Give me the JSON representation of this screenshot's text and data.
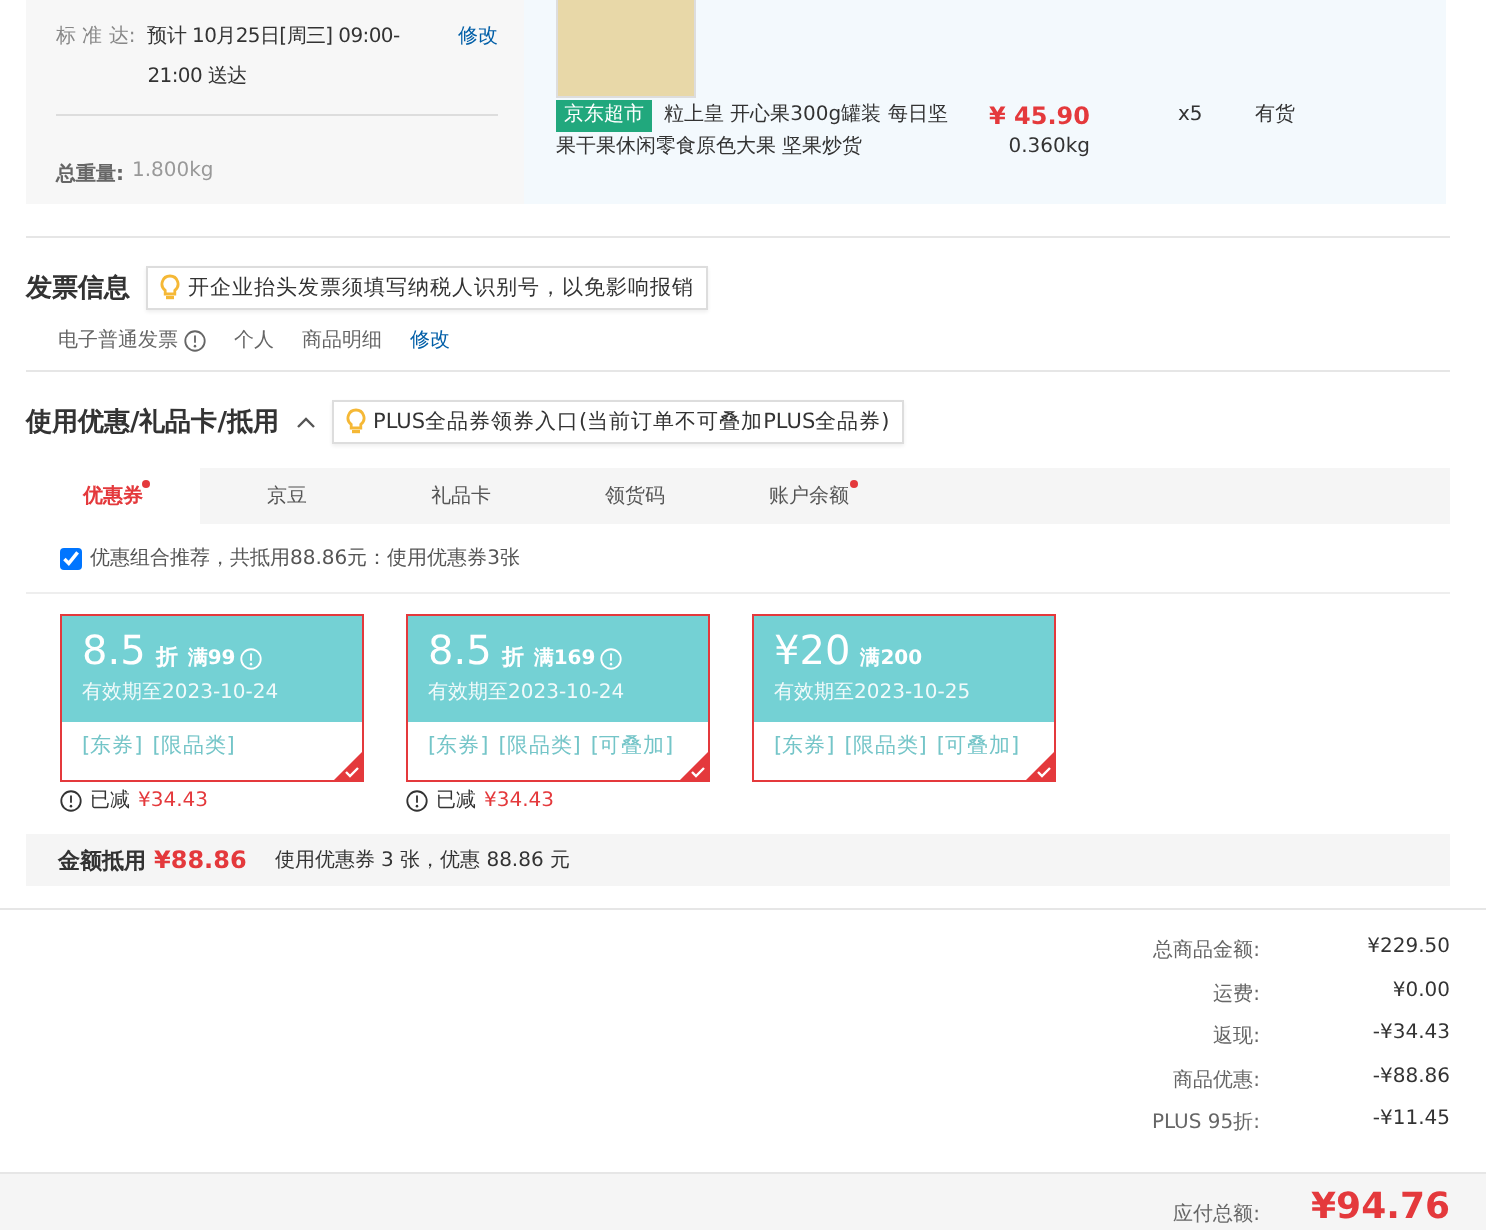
{
  "shipping": {
    "label": "标 准 达:",
    "value": "预计 10月25日[周三] 09:00-21:00 送达",
    "edit": "修改",
    "weight_label": "总重量:",
    "weight": "1.800kg"
  },
  "product": {
    "badge": "京东超市",
    "name_lines": [
      "粒上皇 开心果300g罐装 每日坚",
      "果干果休闲零食原色大果 坚果炒货"
    ],
    "price": "¥ 45.90",
    "weight": "0.360kg",
    "qty": "x5",
    "stock": "有货"
  },
  "invoice": {
    "title": "发票信息",
    "tip": "开企业抬头发票须填写纳税人识别号，以免影响报销",
    "type": "电子普通发票",
    "person": "个人",
    "content": "商品明细",
    "edit": "修改"
  },
  "discount": {
    "title": "使用优惠/礼品卡/抵用",
    "expanded": true,
    "tip": "PLUS全品券领券入口(当前订单不可叠加PLUS全品券)",
    "tabs": [
      {
        "label": "优惠券",
        "selected": true,
        "dot": true
      },
      {
        "label": "京豆",
        "selected": false,
        "dot": false
      },
      {
        "label": "礼品卡",
        "selected": false,
        "dot": false
      },
      {
        "label": "领货码",
        "selected": false,
        "dot": false
      },
      {
        "label": "账户余额",
        "selected": false,
        "dot": true
      }
    ],
    "recommend": {
      "checked": true,
      "text": "优惠组合推荐，共抵用88.86元：使用优惠券3张"
    },
    "coupons": [
      {
        "kind": "discount",
        "amount": "8.5",
        "unit": "折",
        "condition": "满99",
        "info": true,
        "validity": "有效期至2023-10-24",
        "tags": [
          "[东券]",
          "[限品类]"
        ],
        "selected": true,
        "saved_label": "已减",
        "saved": "¥34.43"
      },
      {
        "kind": "discount",
        "amount": "8.5",
        "unit": "折",
        "condition": "满169",
        "info": true,
        "validity": "有效期至2023-10-24",
        "tags": [
          "[东券]",
          "[限品类]",
          "[可叠加]"
        ],
        "selected": true,
        "saved_label": "已减",
        "saved": "¥34.43"
      },
      {
        "kind": "cash",
        "amount": "¥20",
        "condition": "满200",
        "info": false,
        "validity": "有效期至2023-10-25",
        "tags": [
          "[东券]",
          "[限品类]",
          "[可叠加]"
        ],
        "selected": true
      }
    ],
    "summary": {
      "label": "金额抵用",
      "amount": "¥88.86",
      "text": "使用优惠券 3 张，优惠 88.86 元"
    }
  },
  "totals": [
    {
      "label": "总商品金额:",
      "value": "¥229.50"
    },
    {
      "label": "运费:",
      "value": "¥0.00"
    },
    {
      "label": "返现:",
      "value": "-¥34.43"
    },
    {
      "label": "商品优惠:",
      "value": "-¥88.86"
    },
    {
      "label": "PLUS 95折:",
      "value": "-¥11.45"
    }
  ],
  "payable": {
    "label": "应付总额:",
    "value": "¥94.76"
  }
}
